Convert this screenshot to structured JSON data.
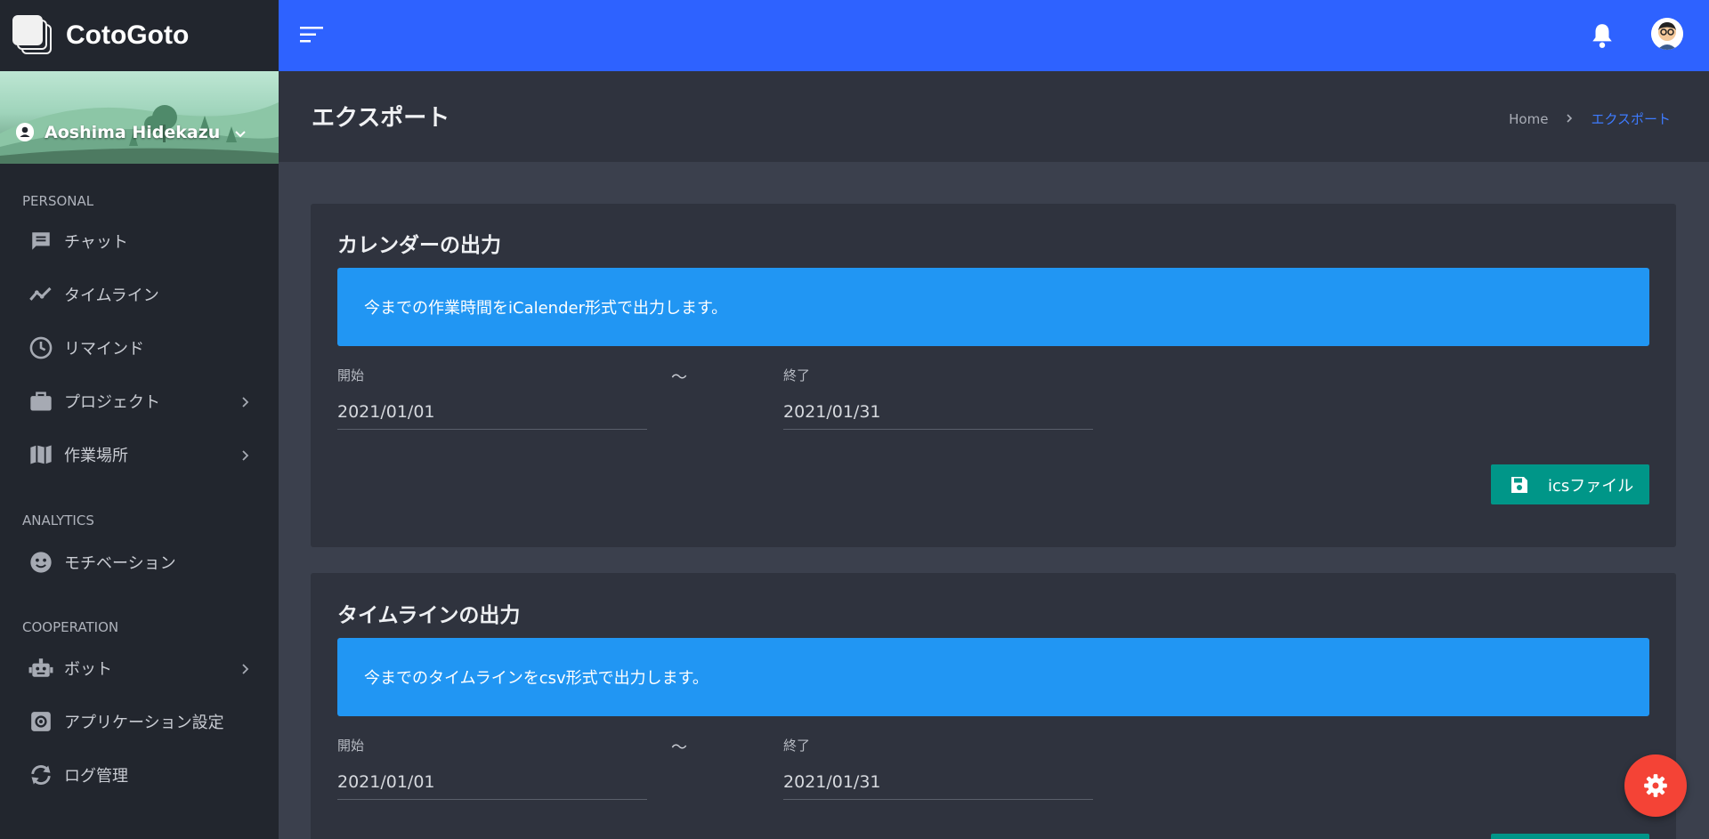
{
  "app": {
    "name": "CotoGoto"
  },
  "user": {
    "name": "Aoshima Hidekazu"
  },
  "sidebar": {
    "sections": [
      {
        "title": "PERSONAL"
      },
      {
        "title": "ANALYTICS"
      },
      {
        "title": "COOPERATION"
      }
    ],
    "items": [
      {
        "label": "チャット",
        "icon": "chat-icon"
      },
      {
        "label": "タイムライン",
        "icon": "timeline-icon"
      },
      {
        "label": "リマインド",
        "icon": "clock-icon"
      },
      {
        "label": "プロジェクト",
        "icon": "briefcase-icon",
        "has_children": true
      },
      {
        "label": "作業場所",
        "icon": "map-icon",
        "has_children": true
      },
      {
        "label": "モチベーション",
        "icon": "face-icon"
      },
      {
        "label": "ボット",
        "icon": "robot-icon",
        "has_children": true
      },
      {
        "label": "アプリケーション設定",
        "icon": "settings-icon"
      },
      {
        "label": "ログ管理",
        "icon": "sync-icon"
      }
    ]
  },
  "header": {
    "title": "エクスポート",
    "breadcrumb": {
      "home": "Home",
      "current": "エクスポート"
    }
  },
  "cards": [
    {
      "title": "カレンダーの出力",
      "info": "今までの作業時間をiCalender形式で出力します。",
      "start_label": "開始",
      "start_value": "2021/01/01",
      "separator": "〜",
      "end_label": "終了",
      "end_value": "2021/01/31",
      "button_label": "icsファイル"
    },
    {
      "title": "タイムラインの出力",
      "info": "今までのタイムラインをcsv形式で出力します。",
      "start_label": "開始",
      "start_value": "2021/01/01",
      "separator": "〜",
      "end_label": "終了",
      "end_value": "2021/01/31"
    }
  ],
  "colors": {
    "topbar": "#2e62ff",
    "sidebar": "#22262e",
    "info": "#2196f3",
    "button": "#009688",
    "fab": "#f44336"
  }
}
